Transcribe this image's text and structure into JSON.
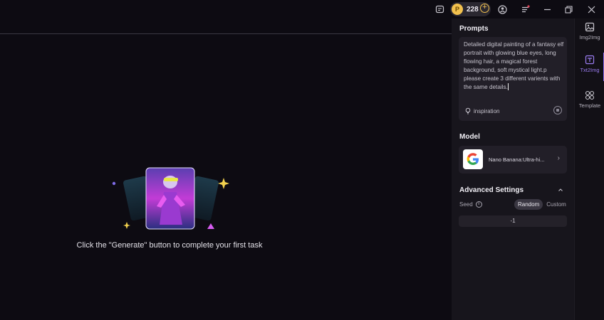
{
  "window": {
    "coins": "228"
  },
  "canvas": {
    "empty_message": "Click the \"Generate\" button to complete your first task"
  },
  "panel": {
    "prompts_title": "Prompts",
    "prompt_text": "Detailed digital painting of a fantasy elf portrait with glowing blue eyes, long flowing hair, a magical forest background, soft mystical light.p please create 3 different varients with the same details.",
    "inspiration_label": "inspiration",
    "model_title": "Model",
    "model_name": "Nano Banana:Ultra-hi...",
    "advanced_title": "Advanced Settings",
    "seed_label": "Seed",
    "seed_options": [
      "Random",
      "Custom"
    ],
    "seed_selected": "Random",
    "seed_value": "-1"
  },
  "rail": {
    "items": [
      {
        "label": "Img2Img",
        "icon": "image-icon",
        "active": false
      },
      {
        "label": "Txt2Img",
        "icon": "text-image-icon",
        "active": true
      },
      {
        "label": "Template",
        "icon": "template-grid-icon",
        "active": false
      }
    ]
  },
  "colors": {
    "background": "#0d0b12",
    "panel": "#17151c",
    "accent": "#8b6cf2",
    "coin": "#f2c14e"
  }
}
